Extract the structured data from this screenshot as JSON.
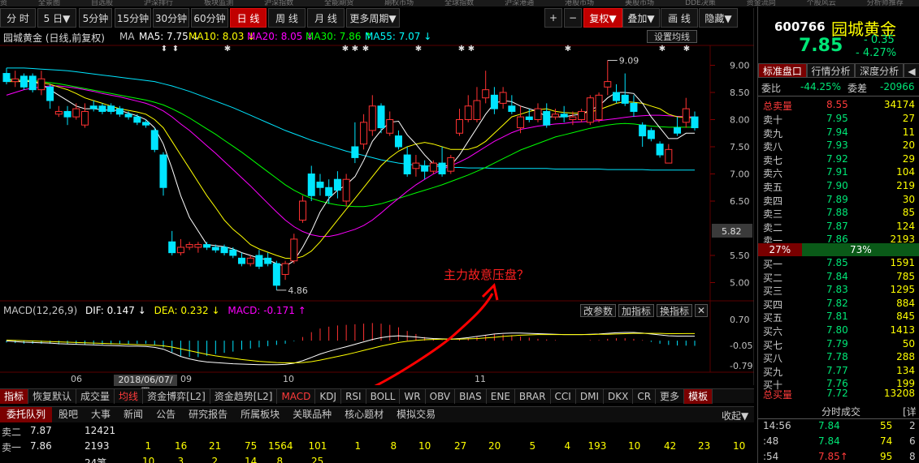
{
  "top_strip_labels": [
    "资",
    "全景图",
    "自选股",
    "沪深排行",
    "板块监测",
    "沪深指数",
    "全能期货",
    "期权市场",
    "全球指数",
    "沪深港通",
    "港股市场",
    "美股市场",
    "DDE决策",
    "资金流向",
    "个股风云",
    "分析师推荐"
  ],
  "toolbar": {
    "items": [
      "分 时",
      "5 日▼",
      "5分钟",
      "15分钟",
      "30分钟",
      "60分钟",
      "日 线",
      "周 线",
      "月 线",
      "更多周期▼"
    ],
    "right_items": [
      "+",
      "−",
      "复权▼",
      "叠加▼",
      "画 线",
      "隐藏▼"
    ]
  },
  "stock": {
    "code": "600766",
    "name": "园城黄金",
    "price": "7.85",
    "change": "- 0.35",
    "pct": "- 4.27%",
    "chart_title": "园城黄金 (日线,前复权)"
  },
  "ma_legend": [
    {
      "label": "MA",
      "color": "#c8c8c8"
    },
    {
      "label": "MA5: 7.75 ↓",
      "color": "#ffffff"
    },
    {
      "label": "MA10: 8.03 ↓",
      "color": "#ffff00"
    },
    {
      "label": "MA20: 8.05 ↓",
      "color": "#ff00ff"
    },
    {
      "label": "MA30: 7.86 ↑",
      "color": "#00ff00"
    },
    {
      "label": "MA55: 7.07 ↓",
      "color": "#00ffff"
    }
  ],
  "set_ma_button": "设置均线",
  "annotation": "主力故意压盘？",
  "price_marks": {
    "high": "9.09",
    "low": "4.86",
    "current_box": "5.82"
  },
  "markers": [
    "⬍",
    "⬍",
    "✱",
    "✱",
    "✱",
    "✱",
    "✱",
    "✱",
    "✱",
    "✱",
    "✱",
    "✱"
  ],
  "macd": {
    "header": "MACD(12,26,9)",
    "dif": "DIF: 0.147 ↓",
    "dea": "DEA: 0.232 ↓",
    "macd": "MACD: -0.171 ↑",
    "buttons": [
      "改参数",
      "加指标",
      "换指标",
      "✕"
    ]
  },
  "x_axis": {
    "labels": [
      "06",
      "09",
      "10",
      "11"
    ],
    "date_box": "2018/06/07/四"
  },
  "indicators": [
    "指标",
    "恢复默认",
    "成交量",
    "均线",
    "资金博弈[L2]",
    "资金趋势[L2]",
    "MACD",
    "KDJ",
    "RSI",
    "BOLL",
    "WR",
    "OBV",
    "BIAS",
    "ENE",
    "BRAR",
    "CCI",
    "DMI",
    "DKX",
    "CR",
    "更多",
    "模板"
  ],
  "bottom_tabs": [
    "委托队列",
    "股吧",
    "大事",
    "新闻",
    "公告",
    "研究报告",
    "所属板块",
    "关联品种",
    "核心题材",
    "模拟交易"
  ],
  "collapse_label": "收起▼",
  "order_queue": {
    "rows": [
      {
        "label": "卖二",
        "price": "7.87",
        "vol": "12421"
      },
      {
        "label": "卖一",
        "price": "7.86",
        "vol": "2193",
        "queue": [
          "1",
          "16",
          "21",
          "75",
          "1564",
          "101",
          "1",
          "8",
          "10",
          "27",
          "20",
          "5",
          "4",
          "193",
          "10",
          "42",
          "23",
          "10"
        ]
      },
      {
        "label": "",
        "price": "",
        "vol": "24笔",
        "queue": [
          "10",
          "3",
          "2",
          "14",
          "8",
          "25"
        ]
      }
    ]
  },
  "right_panel": {
    "tabs": [
      "标准盘口",
      "行情分析",
      "深度分析",
      "◀"
    ],
    "weibi_label": "委比",
    "weibi": "-44.25%",
    "weicha_label": "委差",
    "weicha": "-20966",
    "total_sell": {
      "label": "总卖量",
      "price": "8.55",
      "vol": "34174"
    },
    "asks": [
      {
        "label": "卖十",
        "price": "7.95",
        "vol": "27"
      },
      {
        "label": "卖九",
        "price": "7.94",
        "vol": "11"
      },
      {
        "label": "卖八",
        "price": "7.93",
        "vol": "20"
      },
      {
        "label": "卖七",
        "price": "7.92",
        "vol": "29"
      },
      {
        "label": "卖六",
        "price": "7.91",
        "vol": "104"
      },
      {
        "label": "卖五",
        "price": "7.90",
        "vol": "219"
      },
      {
        "label": "卖四",
        "price": "7.89",
        "vol": "30"
      },
      {
        "label": "卖三",
        "price": "7.88",
        "vol": "85"
      },
      {
        "label": "卖二",
        "price": "7.87",
        "vol": "124"
      },
      {
        "label": "卖一",
        "price": "7.86",
        "vol": "2193"
      }
    ],
    "pct_left": "27%",
    "pct_right": "73%",
    "bids": [
      {
        "label": "买一",
        "price": "7.85",
        "vol": "1591"
      },
      {
        "label": "买二",
        "price": "7.84",
        "vol": "785"
      },
      {
        "label": "买三",
        "price": "7.83",
        "vol": "1295"
      },
      {
        "label": "买四",
        "price": "7.82",
        "vol": "884"
      },
      {
        "label": "买五",
        "price": "7.81",
        "vol": "845"
      },
      {
        "label": "买六",
        "price": "7.80",
        "vol": "1413"
      },
      {
        "label": "买七",
        "price": "7.79",
        "vol": "50"
      },
      {
        "label": "买八",
        "price": "7.78",
        "vol": "288"
      },
      {
        "label": "买九",
        "price": "7.77",
        "vol": "134"
      },
      {
        "label": "买十",
        "price": "7.76",
        "vol": "199"
      }
    ],
    "total_buy": {
      "label": "总买量",
      "price": "7.72",
      "vol": "13208"
    },
    "trades_title": "分时成交",
    "trades_more": "[详",
    "trades": [
      {
        "time": "14:56",
        "price": "7.84",
        "vol": "55",
        "dir": "2"
      },
      {
        "time": ":48",
        "price": "7.84",
        "vol": "74",
        "dir": "6"
      },
      {
        "time": ":54",
        "price": "7.85↑",
        "vol": "95",
        "dir": "8"
      }
    ]
  },
  "chart_data": {
    "type": "candlestick",
    "price_axis": [
      "9.00",
      "8.50",
      "8.00",
      "7.50",
      "7.00",
      "6.50",
      "5.50",
      "5.00"
    ],
    "macd_axis": [
      "0.70",
      "-0.05",
      "-0.79"
    ],
    "candles": [
      [
        8.85,
        8.95,
        8.7,
        8.65
      ],
      [
        8.7,
        8.9,
        8.75,
        8.6
      ],
      [
        8.8,
        8.85,
        8.6,
        8.55
      ],
      [
        8.8,
        8.85,
        8.55,
        8.5
      ],
      [
        8.55,
        8.9,
        8.75,
        8.45
      ],
      [
        8.6,
        8.65,
        8.35,
        8.2
      ],
      [
        8.1,
        8.25,
        8.15,
        8.05
      ],
      [
        8.15,
        8.25,
        8.05,
        7.9
      ],
      [
        8.05,
        8.3,
        8.2,
        8.0
      ],
      [
        7.9,
        8.3,
        8.15,
        7.85
      ],
      [
        8.25,
        8.35,
        8.2,
        8.15
      ],
      [
        8.25,
        8.3,
        8.15,
        8.1
      ],
      [
        8.25,
        8.3,
        8.15,
        8.1
      ],
      [
        8.2,
        8.25,
        8.1,
        8.05
      ],
      [
        8.1,
        8.15,
        8.05,
        8.0
      ],
      [
        8.05,
        8.1,
        7.95,
        7.9
      ],
      [
        7.95,
        8.0,
        7.9,
        7.85
      ],
      [
        7.8,
        7.85,
        7.45,
        7.4
      ],
      [
        7.35,
        7.4,
        6.75,
        6.6
      ],
      [
        5.75,
        5.95,
        5.55,
        5.5
      ],
      [
        5.55,
        5.8,
        5.65,
        5.5
      ],
      [
        5.65,
        5.75,
        5.7,
        5.6
      ],
      [
        5.65,
        5.75,
        5.7,
        5.55
      ],
      [
        5.7,
        5.75,
        5.65,
        5.6
      ],
      [
        5.65,
        5.7,
        5.6,
        5.55
      ],
      [
        5.65,
        5.7,
        5.55,
        5.5
      ],
      [
        5.6,
        5.65,
        5.5,
        5.45
      ],
      [
        5.45,
        5.55,
        5.35,
        5.3
      ],
      [
        5.35,
        5.5,
        5.45,
        5.3
      ],
      [
        5.5,
        5.6,
        5.3,
        5.25
      ],
      [
        5.45,
        5.55,
        5.35,
        5.3
      ],
      [
        5.35,
        5.4,
        4.95,
        4.86
      ],
      [
        5.15,
        5.4,
        5.35,
        5.05
      ],
      [
        5.4,
        5.9,
        5.8,
        5.35
      ],
      [
        6.15,
        6.6,
        6.5,
        6.1
      ],
      [
        7.0,
        7.15,
        6.6,
        6.5
      ],
      [
        6.85,
        7.0,
        6.75,
        6.6
      ],
      [
        6.75,
        6.9,
        6.6,
        6.45
      ],
      [
        6.9,
        7.05,
        6.7,
        6.55
      ],
      [
        6.5,
        7.0,
        6.9,
        6.4
      ],
      [
        7.5,
        7.95,
        7.3,
        7.2
      ],
      [
        7.55,
        8.1,
        7.95,
        7.45
      ],
      [
        7.8,
        8.45,
        8.25,
        7.7
      ],
      [
        8.25,
        8.3,
        7.85,
        7.75
      ],
      [
        7.75,
        8.15,
        8.0,
        7.7
      ],
      [
        7.7,
        7.8,
        7.5,
        7.45
      ],
      [
        7.35,
        7.5,
        7.0,
        6.95
      ],
      [
        7.1,
        7.35,
        7.2,
        6.95
      ],
      [
        7.15,
        7.25,
        7.05,
        6.9
      ],
      [
        7.05,
        7.25,
        7.2,
        7.0
      ],
      [
        7.2,
        7.5,
        7.0,
        6.95
      ],
      [
        7.05,
        7.35,
        7.3,
        7.0
      ],
      [
        7.75,
        8.2,
        8.0,
        7.7
      ],
      [
        8.0,
        8.45,
        8.25,
        7.95
      ],
      [
        8.0,
        8.6,
        8.35,
        7.95
      ],
      [
        8.4,
        8.9,
        8.55,
        8.3
      ],
      [
        8.45,
        8.6,
        8.2,
        8.1
      ],
      [
        8.3,
        8.6,
        8.5,
        8.2
      ],
      [
        8.25,
        8.45,
        8.15,
        8.1
      ],
      [
        7.85,
        8.25,
        8.05,
        7.75
      ],
      [
        8.05,
        8.2,
        8.0,
        7.95
      ],
      [
        8.0,
        8.3,
        8.2,
        7.95
      ],
      [
        8.15,
        8.3,
        7.9,
        7.85
      ],
      [
        8.05,
        8.2,
        8.1,
        8.0
      ],
      [
        8.1,
        8.25,
        8.05,
        7.95
      ],
      [
        8.0,
        8.15,
        8.05,
        7.9
      ],
      [
        8.0,
        8.2,
        8.15,
        7.95
      ],
      [
        7.95,
        8.45,
        8.4,
        7.9
      ],
      [
        8.0,
        8.5,
        8.45,
        7.95
      ],
      [
        8.6,
        9.09,
        8.7,
        8.45
      ],
      [
        8.5,
        8.65,
        8.35,
        8.3
      ],
      [
        8.45,
        8.85,
        8.3,
        8.25
      ],
      [
        8.3,
        8.45,
        8.15,
        8.05
      ],
      [
        7.9,
        7.95,
        7.7,
        7.5
      ],
      [
        7.8,
        7.85,
        7.65,
        7.6
      ],
      [
        7.55,
        7.6,
        7.35,
        7.3
      ],
      [
        7.2,
        7.55,
        7.45,
        7.2
      ],
      [
        7.85,
        8.05,
        7.75,
        7.7
      ],
      [
        7.95,
        8.4,
        8.2,
        7.85
      ],
      [
        8.05,
        8.15,
        7.85,
        7.8
      ]
    ],
    "ma5": [
      8.75,
      8.7,
      8.72,
      8.7,
      8.65,
      8.55,
      8.45,
      8.35,
      8.25,
      8.2,
      8.2,
      8.18,
      8.17,
      8.17,
      8.12,
      8.07,
      8.0,
      7.85,
      7.55,
      7.1,
      6.6,
      6.2,
      5.95,
      5.7,
      5.68,
      5.66,
      5.62,
      5.55,
      5.5,
      5.45,
      5.42,
      5.35,
      5.3,
      5.4,
      5.65,
      5.95,
      6.3,
      6.55,
      6.7,
      6.8,
      6.95,
      7.25,
      7.6,
      7.8,
      7.95,
      7.97,
      7.72,
      7.55,
      7.35,
      7.18,
      7.15,
      7.15,
      7.35,
      7.6,
      7.85,
      8.1,
      8.3,
      8.35,
      8.33,
      8.25,
      8.2,
      8.15,
      8.05,
      8.05,
      8.05,
      8.08,
      8.1,
      8.18,
      8.25,
      8.4,
      8.5,
      8.5,
      8.48,
      8.3,
      8.05,
      7.85,
      7.65,
      7.65,
      7.75,
      7.75
    ],
    "ma10": [
      8.7,
      8.7,
      8.7,
      8.7,
      8.68,
      8.65,
      8.6,
      8.55,
      8.48,
      8.4,
      8.35,
      8.3,
      8.25,
      8.2,
      8.17,
      8.14,
      8.1,
      8.0,
      7.85,
      7.6,
      7.35,
      7.1,
      6.85,
      6.6,
      6.38,
      6.15,
      5.98,
      5.85,
      5.7,
      5.62,
      5.56,
      5.5,
      5.45,
      5.44,
      5.48,
      5.58,
      5.75,
      5.95,
      6.15,
      6.35,
      6.55,
      6.75,
      6.95,
      7.15,
      7.3,
      7.42,
      7.5,
      7.55,
      7.58,
      7.55,
      7.5,
      7.45,
      7.45,
      7.45,
      7.5,
      7.6,
      7.75,
      7.9,
      8.05,
      8.1,
      8.15,
      8.18,
      8.2,
      8.15,
      8.13,
      8.12,
      8.12,
      8.14,
      8.18,
      8.24,
      8.3,
      8.33,
      8.32,
      8.3,
      8.25,
      8.2,
      8.1,
      8.05,
      8.04,
      8.03
    ],
    "ma20": [
      8.45,
      8.5,
      8.55,
      8.58,
      8.6,
      8.62,
      8.62,
      8.6,
      8.58,
      8.55,
      8.52,
      8.48,
      8.45,
      8.42,
      8.38,
      8.34,
      8.3,
      8.24,
      8.16,
      8.05,
      7.92,
      7.8,
      7.66,
      7.52,
      7.38,
      7.23,
      7.08,
      6.93,
      6.78,
      6.62,
      6.46,
      6.3,
      6.15,
      6.03,
      5.94,
      5.88,
      5.85,
      5.85,
      5.88,
      5.93,
      5.98,
      6.05,
      6.15,
      6.28,
      6.42,
      6.55,
      6.68,
      6.8,
      6.9,
      7.0,
      7.08,
      7.15,
      7.22,
      7.3,
      7.4,
      7.5,
      7.6,
      7.68,
      7.76,
      7.82,
      7.85,
      7.88,
      7.9,
      7.92,
      7.93,
      7.95,
      7.96,
      7.97,
      7.98,
      8.0,
      8.02,
      8.04,
      8.06,
      8.07,
      8.08,
      8.08,
      8.07,
      8.06,
      8.05,
      8.05
    ],
    "ma30": [
      8.75,
      8.74,
      8.73,
      8.72,
      8.7,
      8.68,
      8.66,
      8.63,
      8.6,
      8.57,
      8.54,
      8.51,
      8.48,
      8.45,
      8.42,
      8.39,
      8.36,
      8.32,
      8.27,
      8.2,
      8.12,
      8.03,
      7.93,
      7.83,
      7.73,
      7.62,
      7.51,
      7.4,
      7.28,
      7.16,
      7.04,
      6.92,
      6.8,
      6.7,
      6.62,
      6.55,
      6.5,
      6.46,
      6.43,
      6.41,
      6.4,
      6.4,
      6.42,
      6.45,
      6.5,
      6.55,
      6.6,
      6.65,
      6.7,
      6.75,
      6.8,
      6.86,
      6.92,
      6.98,
      7.05,
      7.12,
      7.2,
      7.28,
      7.36,
      7.44,
      7.5,
      7.56,
      7.62,
      7.68,
      7.72,
      7.76,
      7.8,
      7.84,
      7.87,
      7.9,
      7.92,
      7.93,
      7.92,
      7.9,
      7.88,
      7.87,
      7.86,
      7.86,
      7.86,
      7.86
    ],
    "ma55": [
      8.95,
      8.95,
      8.95,
      8.94,
      8.93,
      8.92,
      8.91,
      8.9,
      8.88,
      8.86,
      8.84,
      8.82,
      8.8,
      8.78,
      8.76,
      8.74,
      8.72,
      8.7,
      8.66,
      8.62,
      8.57,
      8.52,
      8.46,
      8.4,
      8.34,
      8.28,
      8.22,
      8.15,
      8.08,
      8.01,
      7.94,
      7.87,
      7.8,
      7.74,
      7.68,
      7.62,
      7.57,
      7.52,
      7.47,
      7.42,
      7.38,
      7.34,
      7.3,
      7.26,
      7.23,
      7.2,
      7.18,
      7.16,
      7.15,
      7.14,
      7.13,
      7.12,
      7.12,
      7.11,
      7.11,
      7.11,
      7.1,
      7.1,
      7.1,
      7.1,
      7.1,
      7.1,
      7.1,
      7.09,
      7.09,
      7.09,
      7.09,
      7.09,
      7.09,
      7.08,
      7.08,
      7.08,
      7.08,
      7.08,
      7.07,
      7.07,
      7.07,
      7.07,
      7.07,
      7.07
    ],
    "dif": [
      -0.01,
      -0.03,
      -0.05,
      -0.06,
      -0.07,
      -0.08,
      -0.1,
      -0.11,
      -0.12,
      -0.13,
      -0.14,
      -0.15,
      -0.16,
      -0.17,
      -0.18,
      -0.18,
      -0.19,
      -0.22,
      -0.28,
      -0.4,
      -0.52,
      -0.6,
      -0.66,
      -0.7,
      -0.72,
      -0.74,
      -0.76,
      -0.77,
      -0.78,
      -0.79,
      -0.79,
      -0.79,
      -0.78,
      -0.74,
      -0.66,
      -0.55,
      -0.44,
      -0.35,
      -0.27,
      -0.2,
      -0.12,
      -0.04,
      0.04,
      0.1,
      0.14,
      0.16,
      0.14,
      0.12,
      0.09,
      0.07,
      0.06,
      0.05,
      0.07,
      0.1,
      0.14,
      0.18,
      0.22,
      0.24,
      0.25,
      0.25,
      0.24,
      0.23,
      0.22,
      0.21,
      0.2,
      0.2,
      0.2,
      0.21,
      0.22,
      0.24,
      0.26,
      0.27,
      0.27,
      0.25,
      0.22,
      0.19,
      0.16,
      0.15,
      0.15,
      0.147
    ],
    "dea": [
      0.02,
      0.01,
      0.0,
      -0.01,
      -0.02,
      -0.03,
      -0.04,
      -0.05,
      -0.06,
      -0.07,
      -0.08,
      -0.09,
      -0.1,
      -0.11,
      -0.12,
      -0.13,
      -0.14,
      -0.15,
      -0.17,
      -0.21,
      -0.27,
      -0.33,
      -0.39,
      -0.45,
      -0.5,
      -0.54,
      -0.58,
      -0.62,
      -0.65,
      -0.68,
      -0.7,
      -0.72,
      -0.73,
      -0.73,
      -0.72,
      -0.69,
      -0.64,
      -0.58,
      -0.52,
      -0.46,
      -0.39,
      -0.32,
      -0.25,
      -0.18,
      -0.12,
      -0.06,
      -0.02,
      0.01,
      0.03,
      0.04,
      0.05,
      0.05,
      0.05,
      0.06,
      0.07,
      0.09,
      0.11,
      0.14,
      0.16,
      0.18,
      0.19,
      0.2,
      0.2,
      0.2,
      0.2,
      0.2,
      0.2,
      0.2,
      0.21,
      0.21,
      0.22,
      0.23,
      0.24,
      0.24,
      0.24,
      0.24,
      0.23,
      0.23,
      0.232,
      0.232
    ]
  }
}
